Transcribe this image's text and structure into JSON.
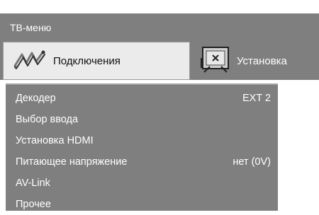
{
  "title": "ТВ-меню",
  "tabs": [
    {
      "label": "Подключения",
      "icon": "connections-icon",
      "active": true
    },
    {
      "label": "Установка",
      "icon": "setup-icon",
      "active": false
    }
  ],
  "menu": {
    "items": [
      {
        "label": "Декодер",
        "value": "EXT 2"
      },
      {
        "label": "Выбор ввода",
        "value": ""
      },
      {
        "label": "Установка HDMI",
        "value": ""
      },
      {
        "label": "Питающее напряжение",
        "value": "нет (0V)"
      },
      {
        "label": "AV-Link",
        "value": ""
      },
      {
        "label": "Прочее",
        "value": ""
      }
    ]
  },
  "colors": {
    "panel": "#7f7f7f",
    "active_tab": "#ebebeb",
    "text_light": "#ffffff",
    "text_dark": "#111111"
  }
}
